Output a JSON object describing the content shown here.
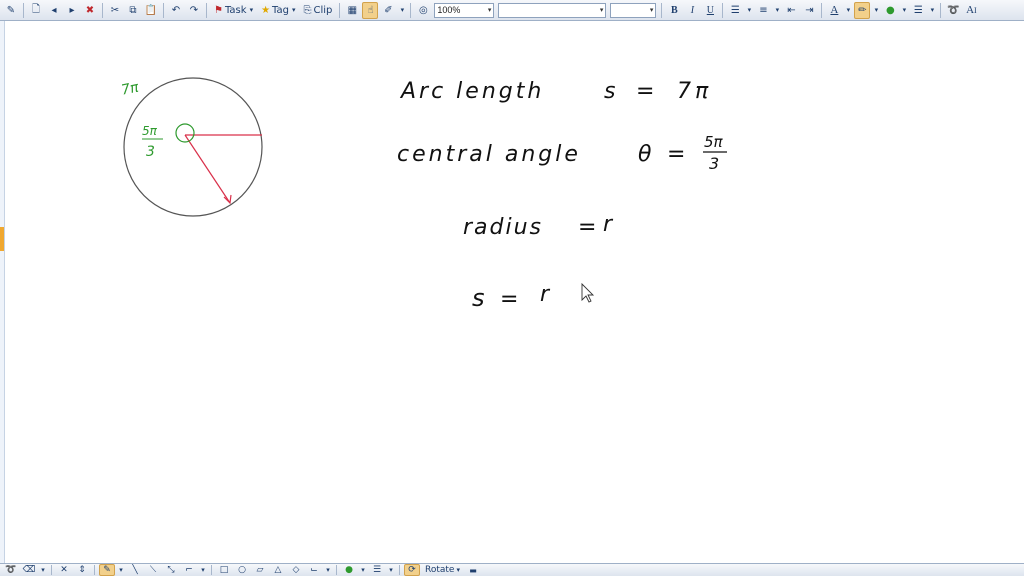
{
  "toolbar": {
    "task_label": "Task",
    "tag_label": "Tag",
    "clip_label": "Clip",
    "zoom_value": "100%",
    "font_name": "",
    "font_size": "",
    "bold_label": "B",
    "italic_label": "I",
    "underline_label": "U",
    "font_color_label": "A",
    "text_label": "A̅"
  },
  "bottom_toolbar": {
    "rotate_label": "Rotate"
  },
  "handwriting": {
    "circle_arc_label": "7π",
    "circle_angle_num": "5π",
    "circle_angle_den": "3",
    "line1": {
      "label": "Arc length",
      "symbol": "s",
      "eq": "=",
      "value": "7π"
    },
    "line2": {
      "label": "central angle",
      "symbol": "θ",
      "eq": "=",
      "num": "5π",
      "den": "3"
    },
    "line3": {
      "label": "radius",
      "eq": "=",
      "value": "r"
    },
    "line4": {
      "symbol": "s",
      "eq": "=",
      "value": "r"
    }
  },
  "colors": {
    "ink": "#111111",
    "green_ink": "#2e9a2e",
    "red_ink": "#d9304a",
    "circle": "#555555",
    "highlight": "#f2d08b"
  }
}
